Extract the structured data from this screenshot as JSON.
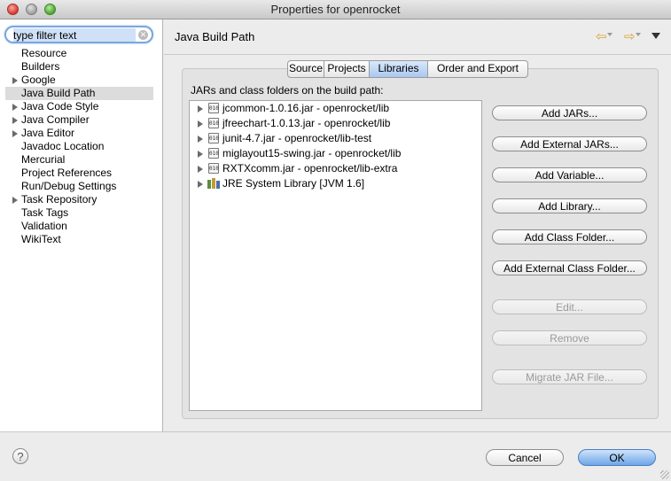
{
  "window": {
    "title": "Properties for openrocket"
  },
  "filter": {
    "value": "type filter text"
  },
  "sidebar": {
    "items": [
      {
        "label": "Resource",
        "expandable": false
      },
      {
        "label": "Builders",
        "expandable": false
      },
      {
        "label": "Google",
        "expandable": true
      },
      {
        "label": "Java Build Path",
        "expandable": false,
        "selected": true
      },
      {
        "label": "Java Code Style",
        "expandable": true
      },
      {
        "label": "Java Compiler",
        "expandable": true
      },
      {
        "label": "Java Editor",
        "expandable": true
      },
      {
        "label": "Javadoc Location",
        "expandable": false
      },
      {
        "label": "Mercurial",
        "expandable": false
      },
      {
        "label": "Project References",
        "expandable": false
      },
      {
        "label": "Run/Debug Settings",
        "expandable": false
      },
      {
        "label": "Task Repository",
        "expandable": true
      },
      {
        "label": "Task Tags",
        "expandable": false
      },
      {
        "label": "Validation",
        "expandable": false
      },
      {
        "label": "WikiText",
        "expandable": false
      }
    ]
  },
  "header": {
    "title": "Java Build Path"
  },
  "tabs": [
    {
      "label": "Source"
    },
    {
      "label": "Projects"
    },
    {
      "label": "Libraries",
      "active": true
    },
    {
      "label": "Order and Export"
    }
  ],
  "main": {
    "list_label": "JARs and class folders on the build path:",
    "entries": [
      {
        "label": "jcommon-1.0.16.jar - openrocket/lib",
        "icon": "jar-icon"
      },
      {
        "label": "jfreechart-1.0.13.jar - openrocket/lib",
        "icon": "jar-icon"
      },
      {
        "label": "junit-4.7.jar - openrocket/lib-test",
        "icon": "jar-icon"
      },
      {
        "label": "miglayout15-swing.jar - openrocket/lib",
        "icon": "jar-icon"
      },
      {
        "label": "RXTXcomm.jar - openrocket/lib-extra",
        "icon": "jar-icon"
      },
      {
        "label": "JRE System Library [JVM 1.6]",
        "icon": "library-icon"
      }
    ],
    "buttons": {
      "add_jars": "Add JARs...",
      "add_external_jars": "Add External JARs...",
      "add_variable": "Add Variable...",
      "add_library": "Add Library...",
      "add_class_folder": "Add Class Folder...",
      "add_external_class_folder": "Add External Class Folder...",
      "edit": "Edit...",
      "remove": "Remove",
      "migrate": "Migrate JAR File..."
    }
  },
  "footer": {
    "cancel": "Cancel",
    "ok": "OK",
    "help_glyph": "?"
  },
  "icons": {
    "jar_glyph": "010"
  }
}
